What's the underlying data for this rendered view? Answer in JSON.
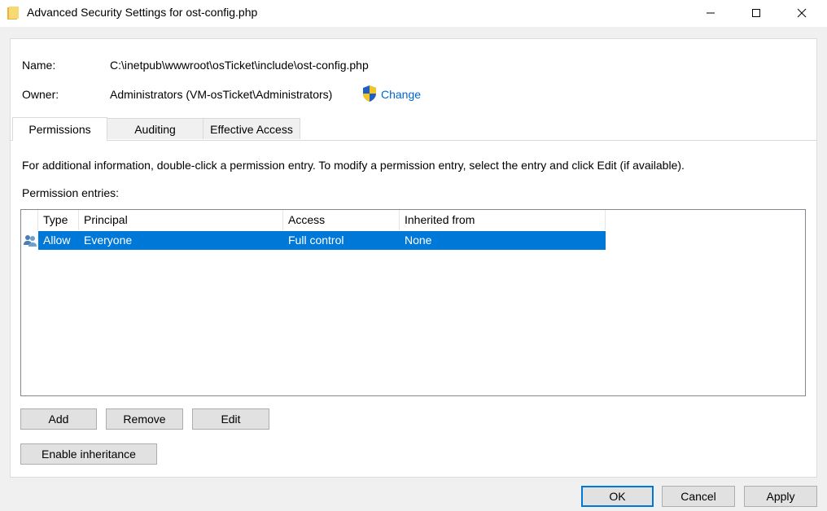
{
  "window": {
    "title": "Advanced Security Settings for ost-config.php",
    "icon": "folder-icon",
    "controls": [
      "minimize-icon",
      "maximize-icon",
      "close-icon"
    ]
  },
  "details": {
    "name_label": "Name:",
    "name_value": "C:\\inetpub\\wwwroot\\osTicket\\include\\ost-config.php",
    "owner_label": "Owner:",
    "owner_value": "Administrators (VM-osTicket\\Administrators)",
    "change_label": "Change"
  },
  "tabs": [
    {
      "label": "Permissions",
      "active": true
    },
    {
      "label": "Auditing",
      "active": false
    },
    {
      "label": "Effective Access",
      "active": false
    }
  ],
  "permissions": {
    "info_text": "For additional information, double-click a permission entry. To modify a permission entry, select the entry and click Edit (if available).",
    "entries_label": "Permission entries:",
    "columns": [
      "Type",
      "Principal",
      "Access",
      "Inherited from"
    ],
    "rows": [
      {
        "type": "Allow",
        "principal": "Everyone",
        "access": "Full control",
        "inherited_from": "None",
        "selected": true,
        "icon": "users-icon"
      }
    ],
    "buttons": {
      "add": "Add",
      "remove": "Remove",
      "edit": "Edit",
      "enable_inheritance": "Enable inheritance"
    }
  },
  "footer": {
    "ok": "OK",
    "cancel": "Cancel",
    "apply": "Apply"
  },
  "colors": {
    "selection": "#0078d7",
    "link": "#0066cc"
  }
}
